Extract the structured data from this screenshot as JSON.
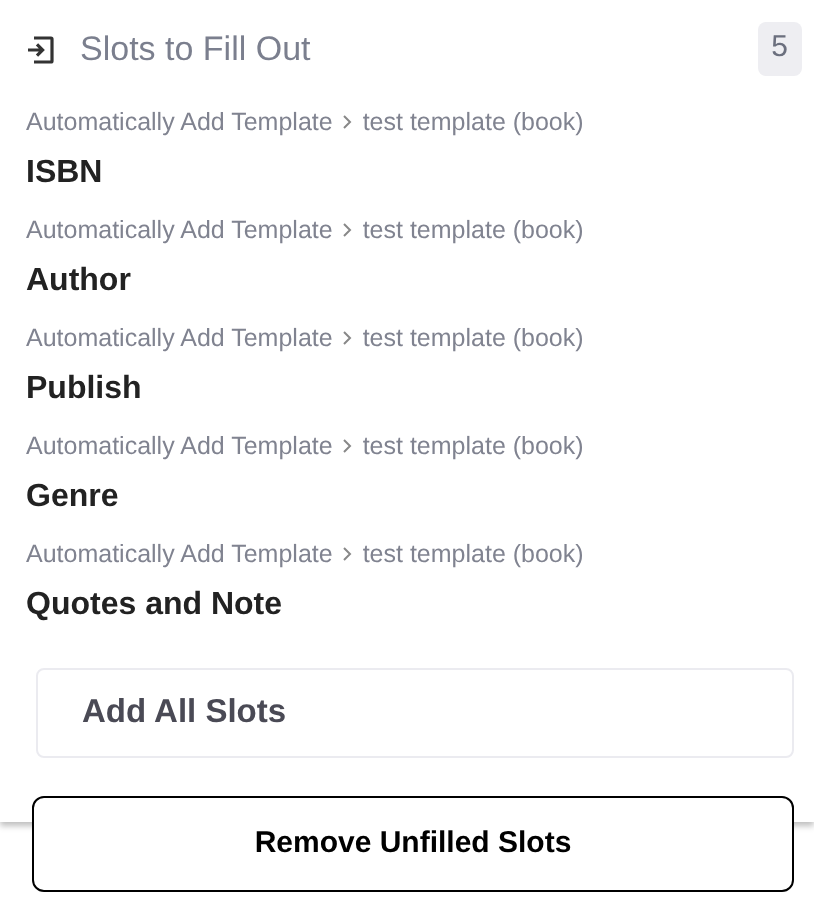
{
  "header": {
    "title": "Slots to Fill Out",
    "count": "5"
  },
  "slots": [
    {
      "path": [
        "Automatically Add Template",
        "test template (book)"
      ],
      "name": "ISBN"
    },
    {
      "path": [
        "Automatically Add Template",
        "test template (book)"
      ],
      "name": "Author"
    },
    {
      "path": [
        "Automatically Add Template",
        "test template (book)"
      ],
      "name": "Publish"
    },
    {
      "path": [
        "Automatically Add Template",
        "test template (book)"
      ],
      "name": "Genre"
    },
    {
      "path": [
        "Automatically Add Template",
        "test template (book)"
      ],
      "name": "Quotes and Note"
    }
  ],
  "add_all_button": "Add All Slots",
  "remove_button": "Remove Unfilled Slots"
}
